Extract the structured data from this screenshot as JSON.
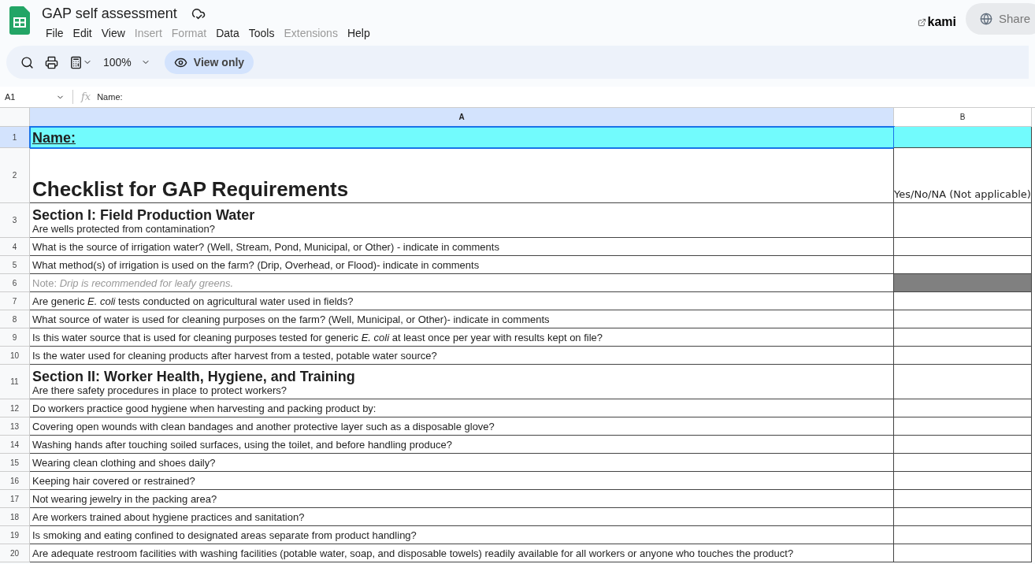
{
  "document": {
    "title": "GAP self assessment"
  },
  "menu": [
    {
      "label": "File",
      "disabled": false
    },
    {
      "label": "Edit",
      "disabled": false
    },
    {
      "label": "View",
      "disabled": false
    },
    {
      "label": "Insert",
      "disabled": true
    },
    {
      "label": "Format",
      "disabled": true
    },
    {
      "label": "Data",
      "disabled": false
    },
    {
      "label": "Tools",
      "disabled": false
    },
    {
      "label": "Extensions",
      "disabled": true
    },
    {
      "label": "Help",
      "disabled": false
    }
  ],
  "brand": "kami",
  "share_button": "Share",
  "toolbar": {
    "zoom": "100%",
    "mode_button": "View only"
  },
  "formula_bar": {
    "cell_ref": "A1",
    "fx": "fx",
    "value": "Name:"
  },
  "columns": [
    {
      "label": "A",
      "selected": true
    },
    {
      "label": "B",
      "selected": false
    }
  ],
  "rows": [
    {
      "number": "1",
      "kind": "name",
      "selected": true,
      "text": "Name:"
    },
    {
      "number": "2",
      "kind": "title",
      "selected": false,
      "text": "Checklist for GAP Requirements",
      "answer": "Yes/No/NA (Not applicable)",
      "shaded": false
    },
    {
      "number": "3",
      "kind": "section",
      "selected": false,
      "heading": "Section I: Field Production Water",
      "text": "Are wells protected from contamination?",
      "shaded": false
    },
    {
      "number": "4",
      "kind": "question",
      "selected": false,
      "text": "What is the source of irrigation water? (Well, Stream, Pond, Municipal, or Other) - indicate in comments",
      "shaded": false
    },
    {
      "number": "5",
      "kind": "question",
      "selected": false,
      "text": "What method(s) of irrigation is used on the farm? (Drip, Overhead, or Flood)- indicate in comments",
      "shaded": false
    },
    {
      "number": "6",
      "kind": "note",
      "selected": false,
      "text": "Note: *Drip is recommended for leafy greens.*",
      "shaded": true
    },
    {
      "number": "7",
      "kind": "question",
      "selected": false,
      "text": "Are generic *E. coli* tests conducted on agricultural water used in fields?",
      "shaded": false
    },
    {
      "number": "8",
      "kind": "question",
      "selected": false,
      "text": "What source of water is used for cleaning purposes on the farm? (Well, Municipal, or Other)- indicate in comments",
      "shaded": false
    },
    {
      "number": "9",
      "kind": "question",
      "selected": false,
      "text": "Is this water source that is used for cleaning purposes tested for generic *E. coli* at least once per year with results kept on file?",
      "shaded": false
    },
    {
      "number": "10",
      "kind": "question",
      "selected": false,
      "text": "Is the water used for cleaning products after harvest from a tested, potable water source?",
      "shaded": false
    },
    {
      "number": "11",
      "kind": "section",
      "selected": false,
      "heading": "Section II: Worker Health, Hygiene, and Training",
      "text": "Are there safety procedures in place to protect workers?",
      "shaded": false
    },
    {
      "number": "12",
      "kind": "question",
      "selected": false,
      "text": "Do workers practice good hygiene when harvesting and packing product by:",
      "shaded": false
    },
    {
      "number": "13",
      "kind": "question",
      "selected": false,
      "text": "Covering open wounds with clean bandages and another protective layer such as a disposable glove?",
      "shaded": false
    },
    {
      "number": "14",
      "kind": "question",
      "selected": false,
      "text": "Washing hands after touching soiled surfaces, using the toilet, and before handling produce?",
      "shaded": false
    },
    {
      "number": "15",
      "kind": "question",
      "selected": false,
      "text": "Wearing clean clothing and shoes daily?",
      "shaded": false
    },
    {
      "number": "16",
      "kind": "question",
      "selected": false,
      "text": "Keeping hair covered or restrained?",
      "shaded": false
    },
    {
      "number": "17",
      "kind": "question",
      "selected": false,
      "text": "Not wearing jewelry in the packing area?",
      "shaded": false
    },
    {
      "number": "18",
      "kind": "question",
      "selected": false,
      "text": "Are workers trained about hygiene practices and sanitation?",
      "shaded": false
    },
    {
      "number": "19",
      "kind": "question",
      "selected": false,
      "text": "Is smoking and eating confined to designated areas separate from product handling?",
      "shaded": false
    },
    {
      "number": "20",
      "kind": "question",
      "selected": false,
      "text": "Are adequate restroom facilities with washing facilities (potable water, soap, and disposable towels) readily available for all workers or anyone who touches the product?",
      "shaded": false
    }
  ]
}
